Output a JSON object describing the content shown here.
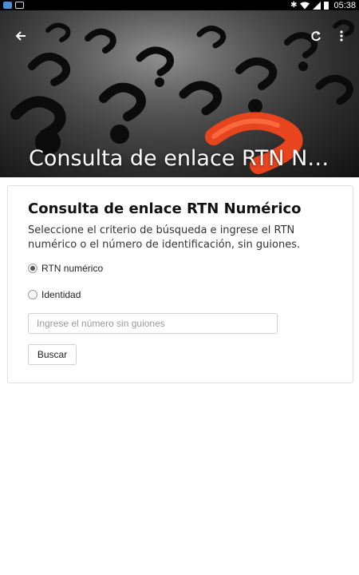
{
  "status_bar": {
    "time": "05:38",
    "left_icons": [
      "app-notification-icon",
      "image-notification-icon"
    ],
    "right_icons": [
      "bluetooth-icon",
      "wifi-icon",
      "signal-icon",
      "battery-icon"
    ]
  },
  "header": {
    "title": "Consulta de enlace RTN N…",
    "actions": [
      "back-arrow-icon",
      "refresh-icon",
      "more-vert-icon"
    ]
  },
  "form": {
    "title": "Consulta de enlace RTN Numérico",
    "description": "Seleccione el criterio de búsqueda e ingrese el RTN numérico o el número de identificación, sin guiones.",
    "options": [
      {
        "label": "RTN numérico",
        "selected": true
      },
      {
        "label": "Identidad",
        "selected": false
      }
    ],
    "input": {
      "value": "",
      "placeholder": "Ingrese el número sin guiones"
    },
    "submit_label": "Buscar"
  },
  "colors": {
    "status_bar_bg": "#000000",
    "hero_dark": "#111111",
    "accent_question_mark": "#e8451e",
    "card_border": "#e0e0e0"
  }
}
